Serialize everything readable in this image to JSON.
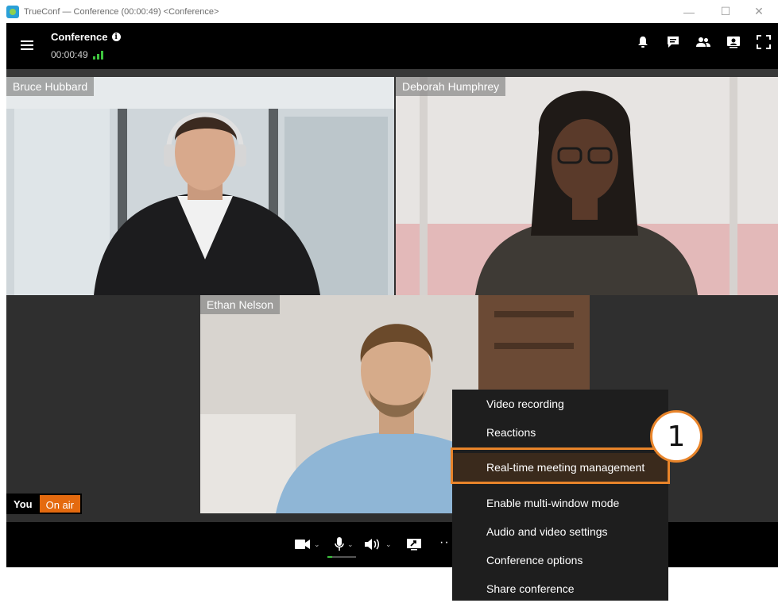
{
  "window": {
    "title": "TrueConf — Conference (00:00:49) <Conference>",
    "minimize": "—",
    "maximize": "☐",
    "close": "✕"
  },
  "header": {
    "conference_name": "Conference",
    "info_icon": "i",
    "timer": "00:00:49",
    "icons": [
      "bell-icon",
      "chat-icon",
      "participants-icon",
      "video-layout-icon",
      "fullscreen-icon"
    ]
  },
  "participants": [
    {
      "name": "Bruce Hubbard"
    },
    {
      "name": "Deborah Humphrey"
    },
    {
      "name": "Ethan Nelson"
    }
  ],
  "self_view": {
    "label": "You",
    "status": "On air",
    "status_color": "#e46a0f"
  },
  "controls": {
    "icons": [
      "camera-icon",
      "microphone-icon",
      "speaker-icon",
      "share-screen-icon",
      "more-icon"
    ],
    "more": "··"
  },
  "more_menu": {
    "items": [
      {
        "label": "Video recording"
      },
      {
        "label": "Reactions"
      },
      {
        "label": "Real-time meeting management"
      },
      {
        "label": "Enable multi-window mode"
      },
      {
        "label": "Audio and video settings"
      },
      {
        "label": "Conference options"
      },
      {
        "label": "Share conference"
      }
    ],
    "highlighted_index": 2
  },
  "callout": {
    "number": "1",
    "color": "#e8842a"
  }
}
